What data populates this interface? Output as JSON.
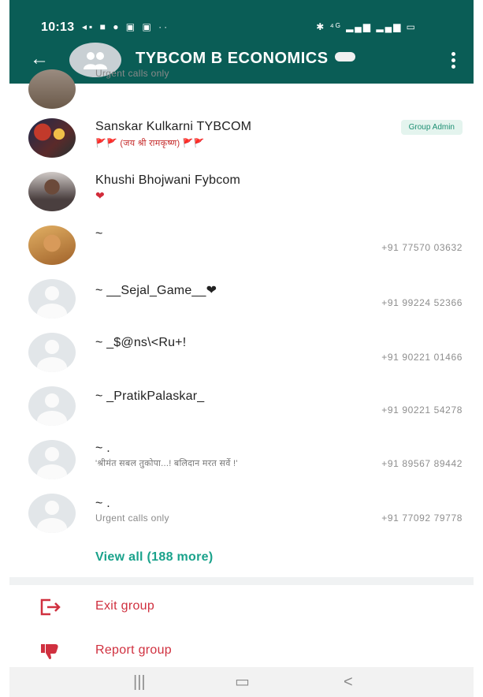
{
  "status_bar": {
    "time": "10:13",
    "left_icons": [
      "notification-icon",
      "message-icon",
      "app-icon",
      "app-icon",
      "more-icon"
    ],
    "right_icons": [
      "alarm-icon",
      "volte-icon",
      "signal-icon",
      "signal-icon",
      "battery-icon"
    ]
  },
  "app_bar": {
    "title": "TYBCOM B ECONOMICS"
  },
  "members": [
    {
      "name": "",
      "about": "Urgent calls only",
      "phone": "",
      "badge": "",
      "avatar": "photo0"
    },
    {
      "name": "Sanskar Kulkarni TYBCOM",
      "about": "🚩🚩 (जय श्री रामकृष्ण) 🚩🚩",
      "phone": "",
      "badge": "Group Admin",
      "avatar": "photo1"
    },
    {
      "name": "Khushi Bhojwani Fybcom",
      "about": "❤",
      "phone": "",
      "badge": "",
      "avatar": "photo2"
    },
    {
      "name": "~",
      "about": "",
      "phone": "+91 77570 03632",
      "badge": "",
      "avatar": "photo3"
    },
    {
      "name": "~ __Sejal_Game__❤",
      "about": "",
      "phone": "+91 99224 52366",
      "badge": "",
      "avatar": "default"
    },
    {
      "name": "~ _$@ns\\<Ru+!",
      "about": "",
      "phone": "+91 90221 01466",
      "badge": "",
      "avatar": "default"
    },
    {
      "name": "~ _PratikPalaskar_",
      "about": "",
      "phone": "+91 90221 54278",
      "badge": "",
      "avatar": "default"
    },
    {
      "name": "~ .",
      "about": "'श्रीमंत सबल तुकोपा...! बलिदान मरत सर्वे !'",
      "phone": "+91 89567 89442",
      "badge": "",
      "avatar": "default"
    },
    {
      "name": "~ .",
      "about": "Urgent calls only",
      "phone": "+91 77092 79778",
      "badge": "",
      "avatar": "default"
    }
  ],
  "view_all_label": "View all (188 more)",
  "actions": {
    "exit_label": "Exit group",
    "report_label": "Report group"
  },
  "colors": {
    "app_bar": "#0a5d56",
    "accent_green": "#1aa28b",
    "danger_red": "#d0303f"
  }
}
